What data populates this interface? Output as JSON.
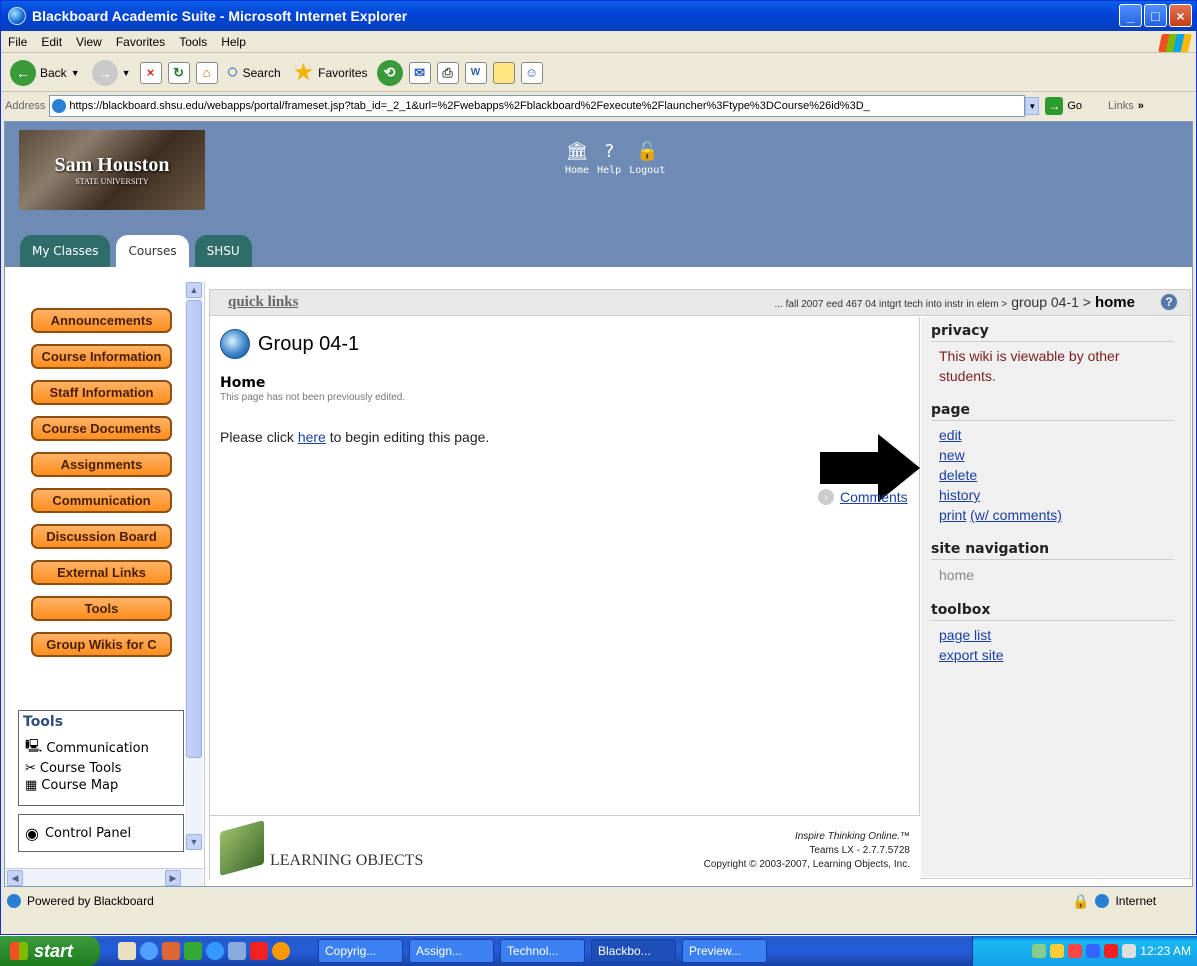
{
  "window": {
    "title": "Blackboard Academic Suite - Microsoft Internet Explorer"
  },
  "menu": [
    "File",
    "Edit",
    "View",
    "Favorites",
    "Tools",
    "Help"
  ],
  "toolbar": {
    "back": "Back",
    "search": "Search",
    "favorites": "Favorites"
  },
  "address": {
    "label": "Address",
    "url": "https://blackboard.shsu.edu/webapps/portal/frameset.jsp?tab_id=_2_1&url=%2Fwebapps%2Fblackboard%2Fexecute%2Flauncher%3Ftype%3DCourse%26id%3D_",
    "go": "Go",
    "links": "Links"
  },
  "header": {
    "logo_text": "Sam Houston",
    "logo_sub": "STATE UNIVERSITY",
    "links": {
      "home": "Home",
      "help": "Help",
      "logout": "Logout"
    },
    "tabs": [
      "My Classes",
      "Courses",
      "SHSU"
    ]
  },
  "nav": {
    "buttons": [
      "Announcements",
      "Course Information",
      "Staff Information",
      "Course Documents",
      "Assignments",
      "Communication",
      "Discussion Board",
      "External Links",
      "Tools",
      "Group Wikis for C"
    ],
    "tools_title": "Tools",
    "tools_items": [
      "Communication",
      "Course Tools",
      "Course Map"
    ],
    "control_panel": "Control Panel"
  },
  "main": {
    "quick_links": "quick links",
    "breadcrumb_prefix": "... fall 2007 eed 467 04 intgrt tech into instr in elem >",
    "breadcrumb_group": "group 04-1 >",
    "breadcrumb_current": "home",
    "wiki_title": "Group 04-1",
    "page_name": "Home",
    "page_note": "This page has not been previously edited.",
    "body_prefix": "Please click ",
    "body_link": "here",
    "body_suffix": " to begin editing this page.",
    "comments": "Comments"
  },
  "sidebar": {
    "privacy_h": "privacy",
    "privacy_text": "This wiki is viewable by other students.",
    "page_h": "page",
    "page_links": {
      "edit": "edit",
      "new": "new",
      "delete": "delete",
      "history": "history",
      "print": "print",
      "print_with": "(w/ comments)"
    },
    "nav_h": "site navigation",
    "nav_home": "home",
    "toolbox_h": "toolbox",
    "toolbox_links": {
      "page_list": "page list",
      "export_site": "export site"
    }
  },
  "footer": {
    "logo": "LEARNING OBJECTS",
    "tagline": "Inspire Thinking Online.™",
    "version": "Teams LX - 2.7.7.5728",
    "copyright": "Copyright © 2003-2007, Learning Objects, Inc."
  },
  "status": {
    "left": "Powered by Blackboard",
    "zone": "Internet"
  },
  "taskbar": {
    "start": "start",
    "tasks": [
      "Copyrig...",
      "Assign...",
      "Technol...",
      "Blackbo...",
      "Preview..."
    ],
    "clock": "12:23 AM"
  }
}
